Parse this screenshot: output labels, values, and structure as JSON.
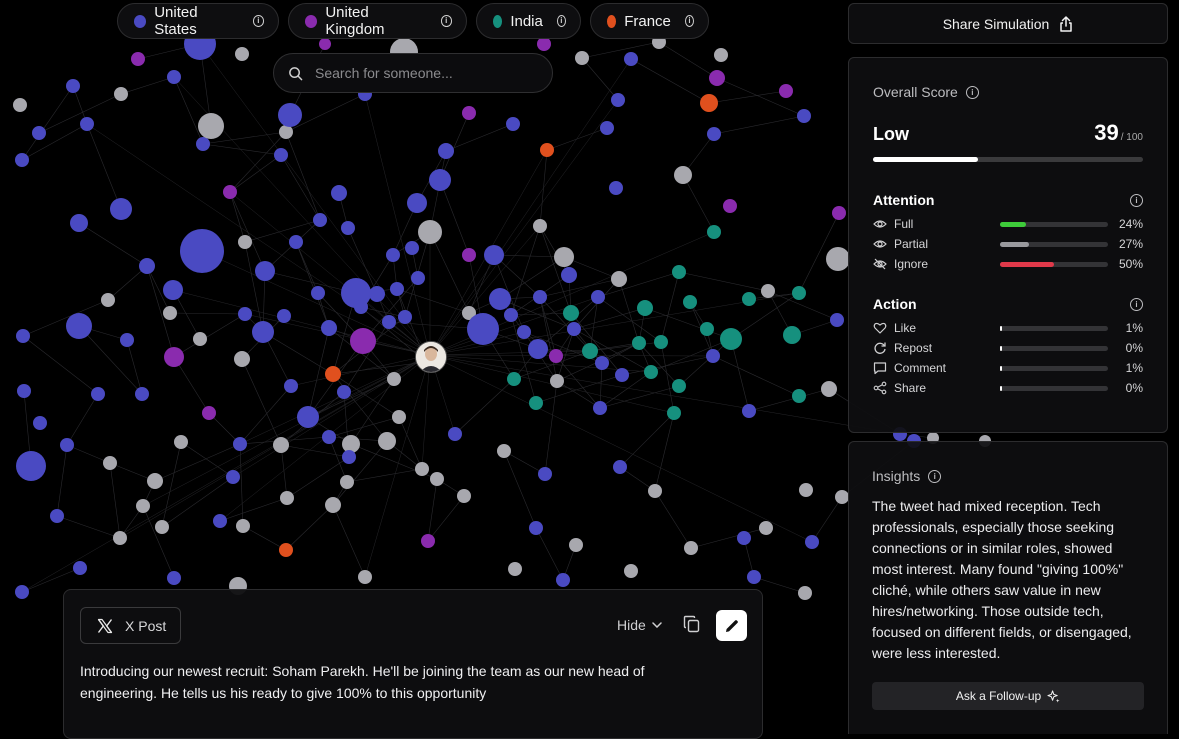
{
  "legend": [
    {
      "label": "United States",
      "color": "#4a4ac2"
    },
    {
      "label": "United Kingdom",
      "color": "#8a2bae"
    },
    {
      "label": "India",
      "color": "#16907e"
    },
    {
      "label": "France",
      "color": "#e0501e"
    }
  ],
  "search": {
    "placeholder": "Search for someone..."
  },
  "share": {
    "label": "Share Simulation"
  },
  "score": {
    "title": "Overall Score",
    "level": "Low",
    "value": "39",
    "max": "/ 100",
    "fraction": 0.39
  },
  "attention": {
    "title": "Attention",
    "items": [
      {
        "label": "Full",
        "pct": "24%",
        "value": 0.24,
        "color": "#3ecb3a",
        "icon": "eye-icon"
      },
      {
        "label": "Partial",
        "pct": "27%",
        "value": 0.27,
        "color": "#9a9a9e",
        "icon": "eye-icon"
      },
      {
        "label": "Ignore",
        "pct": "50%",
        "value": 0.5,
        "color": "#e0394a",
        "icon": "eye-off-icon"
      }
    ]
  },
  "action": {
    "title": "Action",
    "items": [
      {
        "label": "Like",
        "pct": "1%",
        "value": 0.01,
        "color": "#ffffff",
        "icon": "heart-icon"
      },
      {
        "label": "Repost",
        "pct": "0%",
        "value": 0.0,
        "color": "#ffffff",
        "icon": "repost-icon"
      },
      {
        "label": "Comment",
        "pct": "1%",
        "value": 0.01,
        "color": "#ffffff",
        "icon": "comment-icon"
      },
      {
        "label": "Share",
        "pct": "0%",
        "value": 0.0,
        "color": "#ffffff",
        "icon": "share-icon"
      }
    ]
  },
  "insights": {
    "title": "Insights",
    "text": "The tweet had mixed reception. Tech professionals, especially those seeking connections or in similar roles, showed most interest. Many found \"giving 100%\" cliché, while others saw value in new hires/networking. Those outside tech, focused on different fields, or disengaged, were less interested.",
    "followup": "Ask a Follow-up"
  },
  "post": {
    "platform": "X Post",
    "hide": "Hide",
    "text": "Introducing our newest recruit: Soham Parekh. He'll be joining the team as our new head of engineering. He tells us his ready to give 100% to this opportunity"
  }
}
